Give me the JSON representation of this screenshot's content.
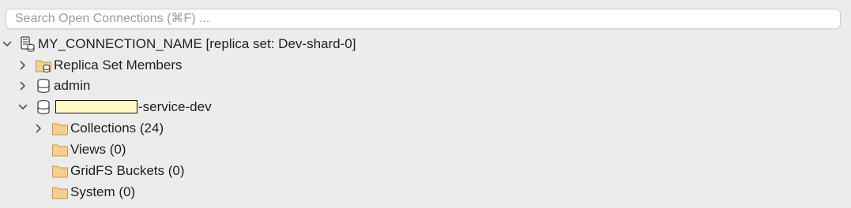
{
  "search": {
    "placeholder": "Search Open Connections (⌘F) ..."
  },
  "tree": {
    "connection": {
      "label": "MY_CONNECTION_NAME [replica set: Dev-shard-0]",
      "icon": "server-connection-icon",
      "expanded": true
    },
    "replica_set_members": {
      "label": "Replica Set Members",
      "icon": "folder-database-icon",
      "expanded": false
    },
    "admin_db": {
      "label": "admin",
      "icon": "database-icon",
      "expanded": false
    },
    "service_db": {
      "label_suffix": "-service-dev",
      "icon": "database-icon",
      "expanded": true,
      "redacted_prefix": true
    },
    "collections": {
      "label": "Collections (24)",
      "icon": "folder-icon",
      "expanded": false
    },
    "views": {
      "label": "Views (0)",
      "icon": "folder-icon"
    },
    "gridfs": {
      "label": "GridFS Buckets (0)",
      "icon": "folder-icon"
    },
    "system": {
      "label": "System (0)",
      "icon": "folder-icon"
    }
  },
  "colors": {
    "background": "#ececec",
    "folder": "#f6cf8e",
    "folder_stroke": "#c79a4d",
    "redaction_fill": "#fffac4"
  }
}
